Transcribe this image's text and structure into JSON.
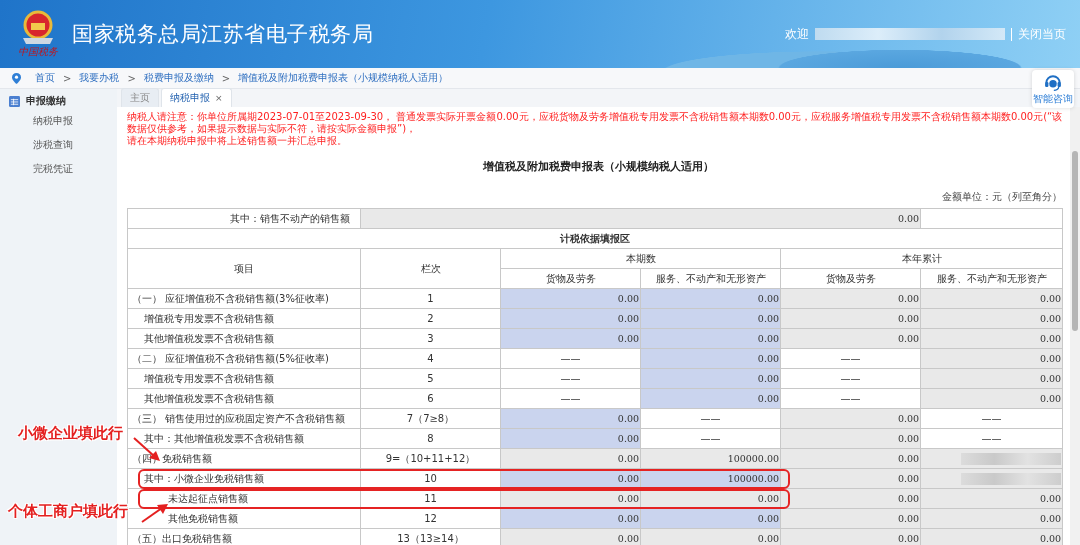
{
  "header": {
    "title": "国家税务总局江苏省电子税务局",
    "logo_text": "中国税务",
    "welcome": "欢迎",
    "close_link": "关闭当页"
  },
  "breadcrumb": {
    "separator": ">",
    "items": [
      "首页",
      "我要办税",
      "税费申报及缴纳",
      "增值税及附加税费申报表（小规模纳税人适用）"
    ]
  },
  "assistant": {
    "label": "智能咨询"
  },
  "sidebar": {
    "title": "申报缴纳",
    "items": [
      {
        "label": "纳税申报",
        "selected": false
      },
      {
        "label": "涉税查询",
        "selected": false
      },
      {
        "label": "完税凭证",
        "selected": false
      }
    ]
  },
  "tabs": [
    {
      "label": "主页",
      "selected": false
    },
    {
      "label": "纳税申报",
      "selected": true,
      "close": "×"
    }
  ],
  "notice": [
    "纳税人请注意：你单位所属期2023-07-01至2023-09-30， 普通发票实际开票金额0.00元，应税货物及劳务增值税专用发票不含税销售额本期数0.00元，应税服务增值税专用发票不含税销售额本期数0.00元(“该数据仅供参考，如果提示数据与实际不符，请按实际金额申报”)，",
    "请在本期纳税申报中将上述销售额一并汇总申报。"
  ],
  "form": {
    "title": "增值税及附加税费申报表（小规模纳税人适用）",
    "unit": "金额单位：元（列至角分）",
    "real_estate": {
      "label": "其中：销售不动产的销售额",
      "value": "0.00"
    },
    "section": "计税依据填报区",
    "columns": {
      "item": "项目",
      "line": "栏次",
      "current": "本期数",
      "ytd": "本年累计",
      "sub": [
        "货物及劳务",
        "服务、不动产和无形资产",
        "货物及劳务",
        "服务、不动产和无形资产"
      ]
    },
    "rows": [
      {
        "item": "（一） 应征增值税不含税销售额(3%征收率)",
        "kind": "section",
        "line": "1",
        "highlighted": false,
        "cells": [
          {
            "kind": "input",
            "value": "0.00"
          },
          {
            "kind": "input",
            "value": "0.00"
          },
          {
            "kind": "calc",
            "value": "0.00"
          },
          {
            "kind": "calc",
            "value": "0.00"
          }
        ]
      },
      {
        "item": "增值税专用发票不含税销售额",
        "kind": "sub",
        "line": "2",
        "highlighted": false,
        "cells": [
          {
            "kind": "input",
            "value": "0.00"
          },
          {
            "kind": "input",
            "value": "0.00"
          },
          {
            "kind": "calc",
            "value": "0.00"
          },
          {
            "kind": "calc",
            "value": "0.00"
          }
        ]
      },
      {
        "item": "其他增值税发票不含税销售额",
        "kind": "sub",
        "line": "3",
        "highlighted": false,
        "cells": [
          {
            "kind": "input",
            "value": "0.00"
          },
          {
            "kind": "input",
            "value": "0.00"
          },
          {
            "kind": "calc",
            "value": "0.00"
          },
          {
            "kind": "calc",
            "value": "0.00"
          }
        ]
      },
      {
        "item": "（二） 应征增值税不含税销售额(5%征收率)",
        "kind": "section",
        "line": "4",
        "highlighted": false,
        "cells": [
          {
            "kind": "na",
            "value": "——"
          },
          {
            "kind": "input",
            "value": "0.00"
          },
          {
            "kind": "na",
            "value": "——"
          },
          {
            "kind": "calc",
            "value": "0.00"
          }
        ]
      },
      {
        "item": "增值税专用发票不含税销售额",
        "kind": "sub",
        "line": "5",
        "highlighted": false,
        "cells": [
          {
            "kind": "na",
            "value": "——"
          },
          {
            "kind": "input",
            "value": "0.00"
          },
          {
            "kind": "na",
            "value": "——"
          },
          {
            "kind": "calc",
            "value": "0.00"
          }
        ]
      },
      {
        "item": "其他增值税发票不含税销售额",
        "kind": "sub",
        "line": "6",
        "highlighted": false,
        "cells": [
          {
            "kind": "na",
            "value": "——"
          },
          {
            "kind": "input",
            "value": "0.00"
          },
          {
            "kind": "na",
            "value": "——"
          },
          {
            "kind": "calc",
            "value": "0.00"
          }
        ]
      },
      {
        "item": "（三） 销售使用过的应税固定资产不含税销售额",
        "kind": "section",
        "line": "7（7≥8）",
        "highlighted": false,
        "cells": [
          {
            "kind": "input",
            "value": "0.00"
          },
          {
            "kind": "na",
            "value": "——"
          },
          {
            "kind": "calc",
            "value": "0.00"
          },
          {
            "kind": "na",
            "value": "——"
          }
        ]
      },
      {
        "item": "其中：其他增值税发票不含税销售额",
        "kind": "sub",
        "line": "8",
        "highlighted": false,
        "cells": [
          {
            "kind": "input",
            "value": "0.00"
          },
          {
            "kind": "na",
            "value": "——"
          },
          {
            "kind": "calc",
            "value": "0.00"
          },
          {
            "kind": "na",
            "value": "——"
          }
        ]
      },
      {
        "item": "（四）免税销售额",
        "kind": "section",
        "line": "9=（10+11+12）",
        "highlighted": false,
        "cells": [
          {
            "kind": "calc",
            "value": "0.00"
          },
          {
            "kind": "calc",
            "value": "100000.00"
          },
          {
            "kind": "calc",
            "value": "0.00"
          },
          {
            "kind": "masked"
          }
        ]
      },
      {
        "item": "其中：小微企业免税销售额",
        "kind": "sub",
        "line": "10",
        "highlighted": true,
        "cells": [
          {
            "kind": "input",
            "value": "0.00"
          },
          {
            "kind": "input",
            "value": "100000.00"
          },
          {
            "kind": "calc",
            "value": "0.00"
          },
          {
            "kind": "masked"
          }
        ]
      },
      {
        "item": "未达起征点销售额",
        "kind": "subsub",
        "line": "11",
        "highlighted": true,
        "cells": [
          {
            "kind": "calc",
            "value": "0.00"
          },
          {
            "kind": "calc",
            "value": "0.00"
          },
          {
            "kind": "calc",
            "value": "0.00"
          },
          {
            "kind": "calc",
            "value": "0.00"
          }
        ]
      },
      {
        "item": "其他免税销售额",
        "kind": "subsub",
        "line": "12",
        "highlighted": false,
        "cells": [
          {
            "kind": "input",
            "value": "0.00"
          },
          {
            "kind": "input",
            "value": "0.00"
          },
          {
            "kind": "calc",
            "value": "0.00"
          },
          {
            "kind": "calc",
            "value": "0.00"
          }
        ]
      },
      {
        "item": "（五）出口免税销售额",
        "kind": "section",
        "line": "13（13≥14）",
        "highlighted": false,
        "cells": [
          {
            "kind": "calc",
            "value": "0.00"
          },
          {
            "kind": "calc",
            "value": "0.00"
          },
          {
            "kind": "calc",
            "value": "0.00"
          },
          {
            "kind": "calc",
            "value": "0.00"
          }
        ]
      }
    ]
  },
  "annotations": [
    {
      "text": "小微企业填此行"
    },
    {
      "text": "个体工商户填此行"
    }
  ]
}
